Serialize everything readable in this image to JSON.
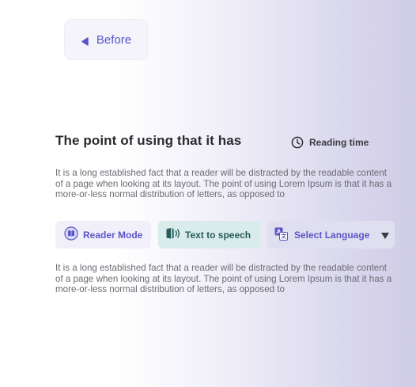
{
  "back_button": {
    "label": "Before"
  },
  "article": {
    "title": "The point of using that it has",
    "reading_time_label": "Reading time",
    "paragraph_1": "It is a long established fact that a reader will be distracted by the readable content of a page when looking at its layout. The point of using Lorem Ipsum is that it has a more-or-less normal distribution of letters, as opposed to",
    "paragraph_2": "It is a long established fact that a reader will be distracted by the readable content of a page when looking at its layout. The point of using Lorem Ipsum is that it has a more-or-less normal distribution of letters, as opposed to"
  },
  "toolbar": {
    "reader_mode_label": "Reader Mode",
    "tts_label": "Text to speech",
    "language_label": "Select Language"
  },
  "icons": {
    "back": "back-arrow-icon",
    "clock": "clock-icon",
    "reader": "book-icon",
    "tts": "speaker-book-icon",
    "language": "translate-icon",
    "dropdown": "chevron-down-icon"
  },
  "colors": {
    "accent": "#5a55c7",
    "tts_accent": "#2b5a5a",
    "title": "#2a2a2e",
    "body_text": "#6b6b73"
  }
}
